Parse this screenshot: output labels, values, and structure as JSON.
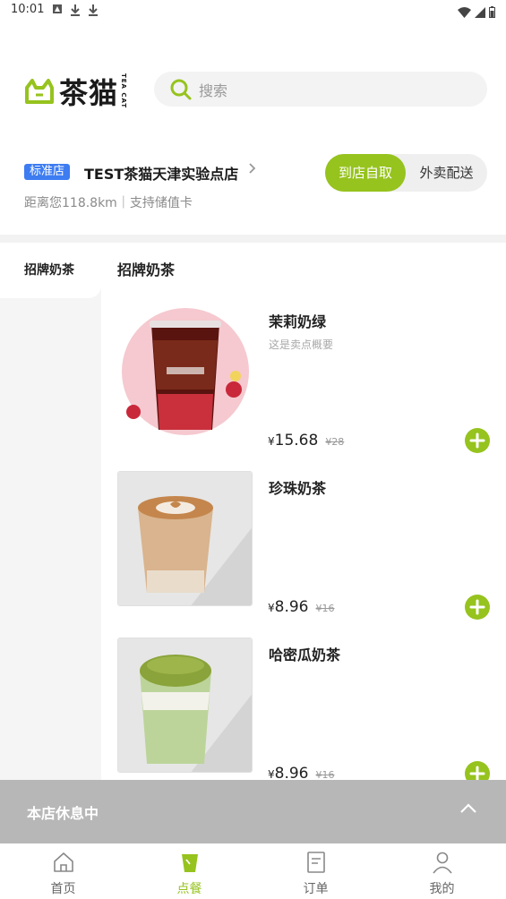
{
  "status_bar": {
    "time": "10:01"
  },
  "header": {
    "logo_text": "茶猫",
    "logo_sub": "TEA CAT",
    "search_placeholder": "搜索"
  },
  "store": {
    "tag": "标准店",
    "name": "TEST茶猫天津实验点店",
    "distance_info": "距离您118.8km｜支持储值卡",
    "mode_pickup": "到店自取",
    "mode_delivery": "外卖配送"
  },
  "sidebar": {
    "items": [
      {
        "label": "招牌奶茶"
      }
    ]
  },
  "menu": {
    "category_title": "招牌奶茶",
    "products": [
      {
        "name": "茉莉奶绿",
        "desc": "这是卖点概要",
        "currency": "¥",
        "price": "15.68",
        "original_price": "¥28"
      },
      {
        "name": "珍珠奶茶",
        "desc": "",
        "currency": "¥",
        "price": "8.96",
        "original_price": "¥16"
      },
      {
        "name": "哈密瓜奶茶",
        "desc": "",
        "currency": "¥",
        "price": "8.96",
        "original_price": "¥16"
      }
    ]
  },
  "closed_bar": {
    "text": "本店休息中"
  },
  "tabs": [
    {
      "label": "首页"
    },
    {
      "label": "点餐"
    },
    {
      "label": "订单"
    },
    {
      "label": "我的"
    }
  ],
  "colors": {
    "accent": "#96c31e",
    "tag_blue": "#3d7cf1",
    "closed_gray": "#b7b7b7"
  }
}
